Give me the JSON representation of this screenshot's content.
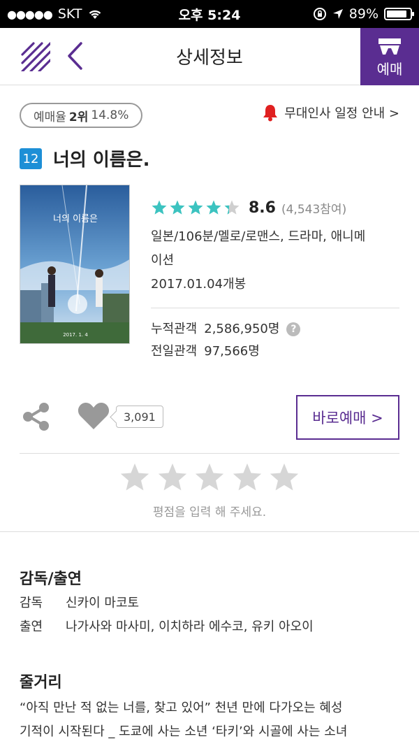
{
  "status_bar": {
    "carrier": "SKT",
    "time": "오후 5:24",
    "battery": "89%",
    "battery_level": 0.89
  },
  "nav": {
    "title": "상세정보",
    "book_label": "예매"
  },
  "info": {
    "rate_label": "예매율",
    "rank": "2위",
    "rate_percent": "14.8%",
    "greeting_link": "무대인사 일정 안내 >"
  },
  "movie": {
    "age_rating": "12",
    "title": "너의 이름은.",
    "poster_title": "너의 이름은",
    "poster_date": "2017. 1. 4",
    "star_rating_out_of_5": 4.3,
    "score": "8.6",
    "participants": "(4,543참여)",
    "genre_line1": "일본/106분/멜로/로맨스, 드라마, 애니메",
    "genre_line2": "이션",
    "release": "2017.01.04개봉",
    "cumulative_label": "누적관객",
    "cumulative_value": "2,586,950명",
    "previous_day_label": "전일관객",
    "previous_day_value": "97,566명"
  },
  "actions": {
    "likes": "3,091",
    "book_button": "바로예매 >"
  },
  "user_rating": {
    "star_count": 5,
    "hint": "평점을 입력 해 주세요."
  },
  "credits": {
    "heading": "감독/출연",
    "director_label": "감독",
    "director": "신카이 마코토",
    "cast_label": "출연",
    "cast": "나가사와 마사미, 이치하라 에수코, 유키 아오이"
  },
  "synopsis": {
    "heading": "줄거리",
    "line1": "“아직 만난 적 없는 너를, 찾고 있어” 천년 만에 다가오는 혜성",
    "line2": "기적이 시작된다 _ 도쿄에 사는 소년 ‘타키’와 시골에 사는 소녀"
  },
  "colors": {
    "brand_purple": "#5a2d91",
    "star_teal": "#3cc3c0",
    "age_blue": "#1d8fd6",
    "alert_red": "#e02020"
  }
}
